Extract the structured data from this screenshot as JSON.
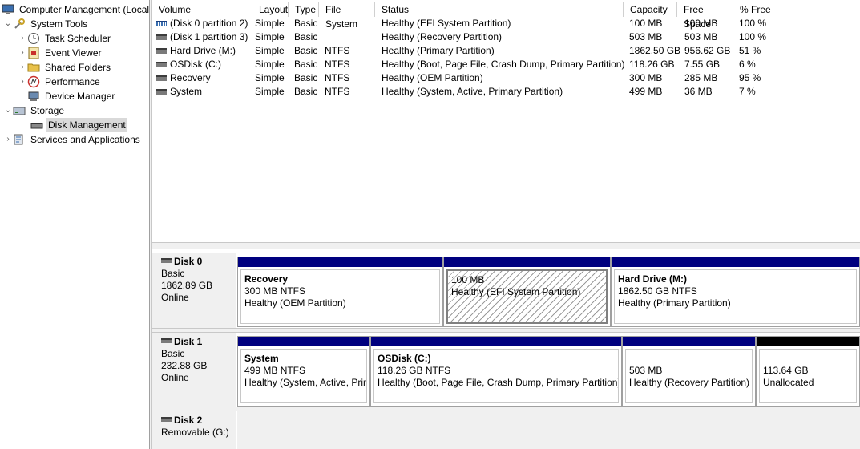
{
  "tree": {
    "root": "Computer Management (Local",
    "system_tools": "System Tools",
    "task_scheduler": "Task Scheduler",
    "event_viewer": "Event Viewer",
    "shared_folders": "Shared Folders",
    "performance": "Performance",
    "device_manager": "Device Manager",
    "storage": "Storage",
    "disk_management": "Disk Management",
    "services_apps": "Services and Applications"
  },
  "columns": {
    "volume": "Volume",
    "layout": "Layout",
    "type": "Type",
    "fs": "File System",
    "status": "Status",
    "capacity": "Capacity",
    "free": "Free Space",
    "pct": "% Free"
  },
  "volumes": [
    {
      "volume": "(Disk 0 partition 2)",
      "layout": "Simple",
      "type": "Basic",
      "fs": "",
      "status": "Healthy (EFI System Partition)",
      "capacity": "100 MB",
      "free": "100 MB",
      "pct": "100 %",
      "icon": "striped"
    },
    {
      "volume": "(Disk 1 partition 3)",
      "layout": "Simple",
      "type": "Basic",
      "fs": "",
      "status": "Healthy (Recovery Partition)",
      "capacity": "503 MB",
      "free": "503 MB",
      "pct": "100 %",
      "icon": "gray"
    },
    {
      "volume": "Hard Drive (M:)",
      "layout": "Simple",
      "type": "Basic",
      "fs": "NTFS",
      "status": "Healthy (Primary Partition)",
      "capacity": "1862.50 GB",
      "free": "956.62 GB",
      "pct": "51 %",
      "icon": "gray"
    },
    {
      "volume": "OSDisk (C:)",
      "layout": "Simple",
      "type": "Basic",
      "fs": "NTFS",
      "status": "Healthy (Boot, Page File, Crash Dump, Primary Partition)",
      "capacity": "118.26 GB",
      "free": "7.55 GB",
      "pct": "6 %",
      "icon": "gray"
    },
    {
      "volume": "Recovery",
      "layout": "Simple",
      "type": "Basic",
      "fs": "NTFS",
      "status": "Healthy (OEM Partition)",
      "capacity": "300 MB",
      "free": "285 MB",
      "pct": "95 %",
      "icon": "gray"
    },
    {
      "volume": "System",
      "layout": "Simple",
      "type": "Basic",
      "fs": "NTFS",
      "status": "Healthy (System, Active, Primary Partition)",
      "capacity": "499 MB",
      "free": "36 MB",
      "pct": "7 %",
      "icon": "gray"
    }
  ],
  "disks": [
    {
      "name": "Disk 0",
      "type": "Basic",
      "size": "1862.89 GB",
      "state": "Online",
      "partitions": [
        {
          "title": "Recovery",
          "size": "300 MB NTFS",
          "status": "Healthy (OEM Partition)",
          "style": "primary"
        },
        {
          "title": "",
          "size": "100 MB",
          "status": "Healthy (EFI System Partition)",
          "style": "hatched"
        },
        {
          "title": "Hard Drive  (M:)",
          "size": "1862.50 GB NTFS",
          "status": "Healthy (Primary Partition)",
          "style": "primary"
        }
      ]
    },
    {
      "name": "Disk 1",
      "type": "Basic",
      "size": "232.88 GB",
      "state": "Online",
      "partitions": [
        {
          "title": "System",
          "size": "499 MB NTFS",
          "status": "Healthy (System, Active, Prir",
          "style": "primary"
        },
        {
          "title": "OSDisk  (C:)",
          "size": "118.26 GB NTFS",
          "status": "Healthy (Boot, Page File, Crash Dump, Primary Partition)",
          "style": "primary"
        },
        {
          "title": "",
          "size": "503 MB",
          "status": "Healthy (Recovery Partition)",
          "style": "primary"
        },
        {
          "title": "",
          "size": "113.64 GB",
          "status": "Unallocated",
          "style": "unallocated"
        }
      ]
    },
    {
      "name": "Disk 2",
      "type": "Removable (G:)",
      "size": "",
      "state": "",
      "partitions": []
    }
  ],
  "colors": {
    "primary_bar": "#00007f",
    "unallocated_bar": "#000000",
    "selected": "#d9d9d9"
  }
}
